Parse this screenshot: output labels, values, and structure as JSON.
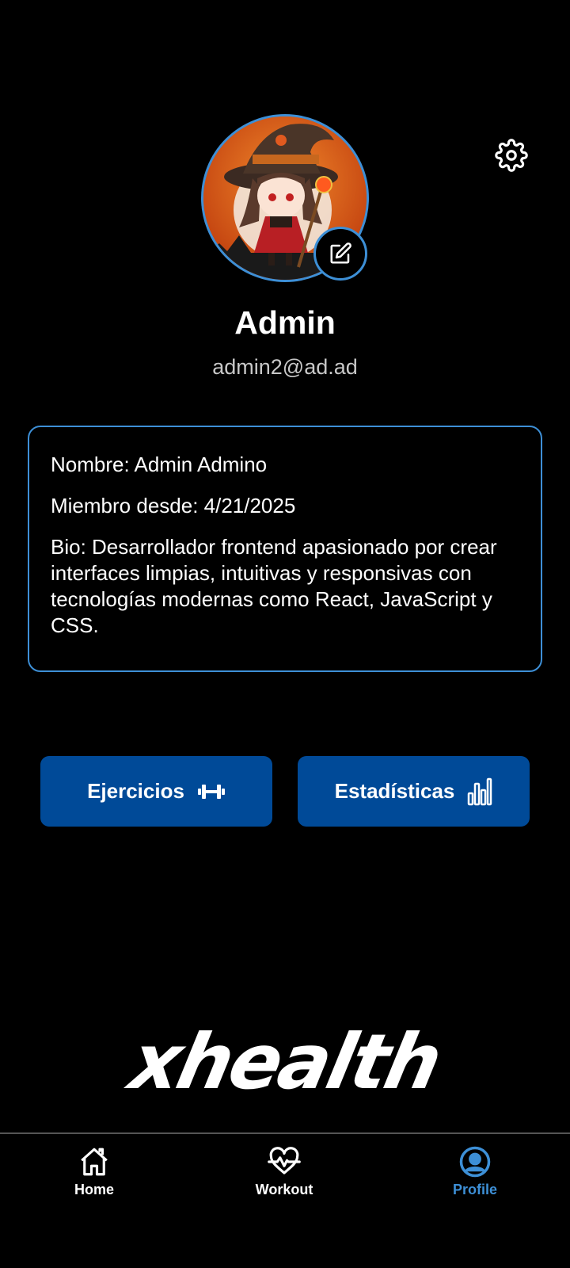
{
  "profile": {
    "name": "Admin",
    "email": "admin2@ad.ad"
  },
  "info": {
    "nombre": "Nombre: Admin Admino",
    "miembro_desde": "Miembro desde: 4/21/2025",
    "bio": "Bio: Desarrollador frontend apasionado por crear interfaces limpias, intuitivas y responsivas con tecnologías modernas como React, JavaScript y CSS."
  },
  "actions": {
    "exercises_label": "Ejercicios",
    "exercises_icon": "dumbbell-icon",
    "stats_label": "Estadísticas",
    "stats_icon": "bar-chart-icon"
  },
  "logo": {
    "text": "xhealth"
  },
  "nav": {
    "items": [
      {
        "label": "Home",
        "icon": "home-icon",
        "active": false
      },
      {
        "label": "Workout",
        "icon": "heartbeat-icon",
        "active": false
      },
      {
        "label": "Profile",
        "icon": "user-circle-icon",
        "active": true
      }
    ]
  },
  "colors": {
    "background": "#000000",
    "accent": "#3d8fd6",
    "button": "#004a98",
    "text": "#ffffff",
    "muted_text": "#c8c8c8"
  }
}
